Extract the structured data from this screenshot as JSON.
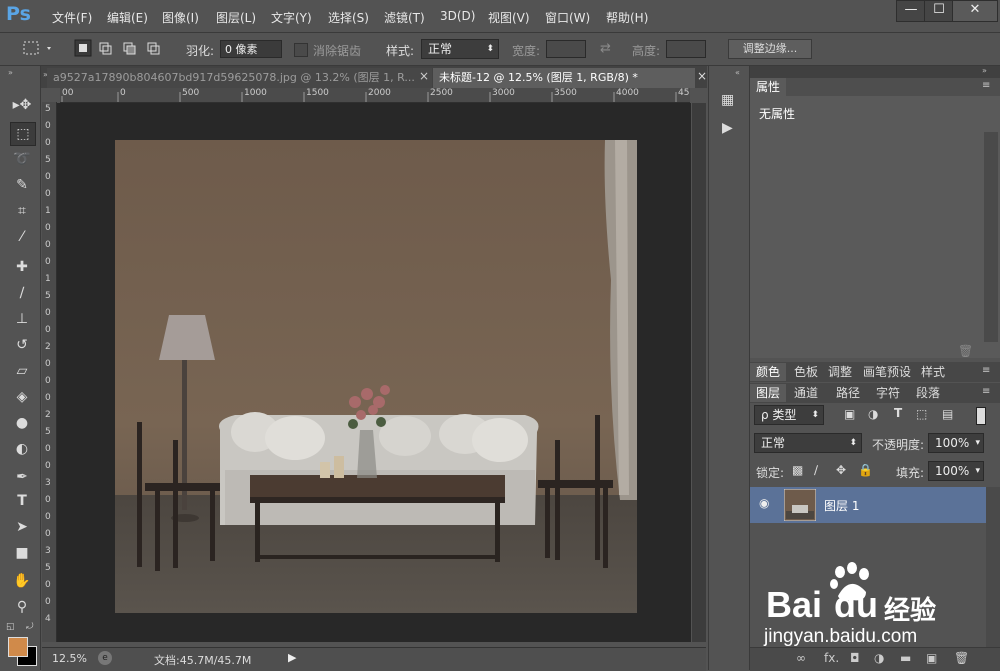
{
  "app": {
    "logo": "Ps"
  },
  "menu": [
    "文件(F)",
    "编辑(E)",
    "图像(I)",
    "图层(L)",
    "文字(Y)",
    "选择(S)",
    "滤镜(T)",
    "3D(D)",
    "视图(V)",
    "窗口(W)",
    "帮助(H)"
  ],
  "window_controls": {
    "minimize": "—",
    "maximize": "☐",
    "close": "✕"
  },
  "options": {
    "feather_label": "羽化:",
    "feather_value": "0 像素",
    "antialias_label": "消除锯齿",
    "style_label": "样式:",
    "style_value": "正常",
    "width_label": "宽度:",
    "height_label": "高度:",
    "refine_edge_button": "调整边缘..."
  },
  "tabs": [
    {
      "label": "a9527a17890b804607bd917d59625078.jpg @ 13.2% (图层 1, R...",
      "close": "×"
    },
    {
      "label": "未标题-12 @ 12.5% (图层 1, RGB/8) *",
      "close": "×"
    }
  ],
  "ruler": {
    "h_ticks": [
      "00",
      "0",
      "500",
      "1000",
      "1500",
      "2000",
      "2500",
      "3000",
      "3500",
      "4000",
      "45"
    ],
    "v_ticks": [
      "5",
      "0",
      "0",
      "5",
      "0",
      "0",
      "1",
      "0",
      "0",
      "0",
      "1",
      "5",
      "0",
      "0",
      "2",
      "0",
      "0",
      "0",
      "2",
      "5",
      "0",
      "0",
      "3",
      "0",
      "0",
      "0",
      "3",
      "5",
      "0",
      "0",
      "4"
    ]
  },
  "status": {
    "zoom": "12.5%",
    "doc_info": "文档:45.7M/45.7M"
  },
  "properties": {
    "tab": "属性",
    "content": "无属性"
  },
  "color_tabs": [
    "颜色",
    "色板",
    "调整",
    "画笔预设",
    "样式"
  ],
  "layers_tabs": [
    "图层",
    "通道",
    "路径",
    "字符",
    "段落"
  ],
  "layers": {
    "filter_kind": "ρ 类型",
    "blend_mode": "正常",
    "opacity_label": "不透明度:",
    "opacity_value": "100%",
    "lock_label": "锁定:",
    "fill_label": "填充:",
    "fill_value": "100%",
    "items": [
      {
        "name": "图层 1"
      }
    ],
    "footer_fx": "fx."
  },
  "watermark": {
    "brand": "Bai",
    "brand2": "du",
    "cn": "经验",
    "url": "jingyan.baidu.com"
  },
  "colors": {
    "foreground": "#d08a4a",
    "background": "#000000",
    "accent": "#5b7298"
  }
}
